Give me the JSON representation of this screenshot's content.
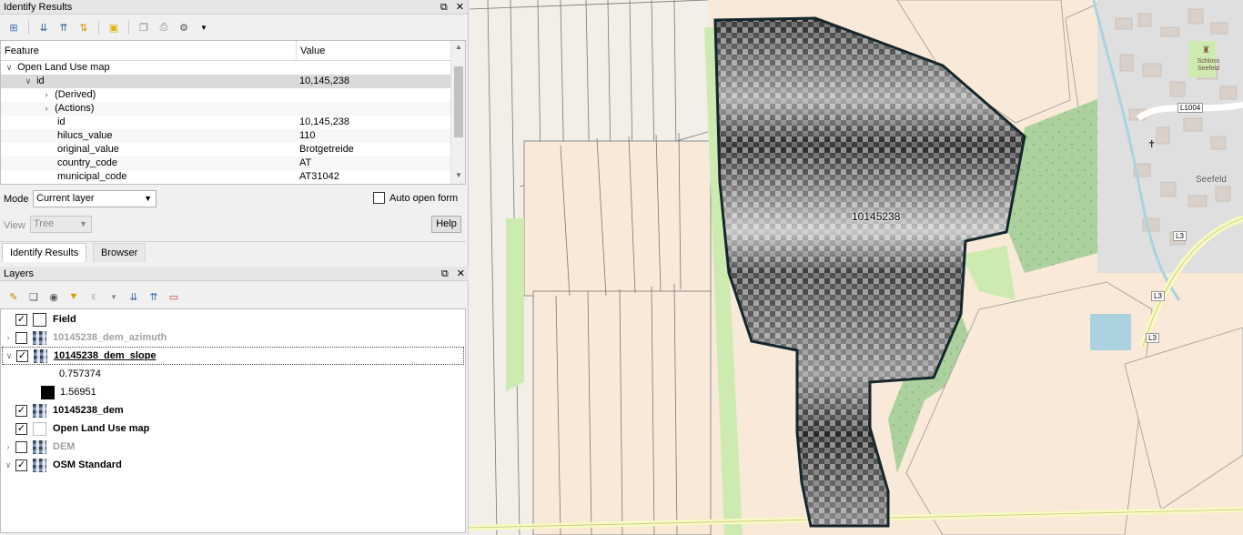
{
  "identify": {
    "title": "Identify Results",
    "columns": [
      "Feature",
      "Value"
    ],
    "rows": [
      {
        "feature": "Open Land Use map",
        "value": ""
      },
      {
        "feature": "id",
        "value": "10,145,238"
      },
      {
        "feature": "(Derived)",
        "value": ""
      },
      {
        "feature": "(Actions)",
        "value": ""
      },
      {
        "feature": "id",
        "value": "10,145,238"
      },
      {
        "feature": "hilucs_value",
        "value": "110"
      },
      {
        "feature": "original_value",
        "value": "Brotgetreide"
      },
      {
        "feature": "country_code",
        "value": "AT"
      },
      {
        "feature": "municipal_code",
        "value": "AT31042"
      }
    ],
    "mode_label": "Mode",
    "mode_value": "Current layer",
    "auto_open_label": "Auto open form",
    "view_label": "View",
    "view_value": "Tree",
    "help_label": "Help",
    "tabs": [
      "Identify Results",
      "Browser"
    ]
  },
  "layers": {
    "title": "Layers",
    "items": [
      {
        "name": "Field",
        "checked": true
      },
      {
        "name": "10145238_dem_azimuth",
        "checked": false
      },
      {
        "name": "10145238_dem_slope",
        "checked": true
      },
      {
        "name": "0.757374"
      },
      {
        "name": "1.56951"
      },
      {
        "name": "10145238_dem",
        "checked": true
      },
      {
        "name": "Open Land Use map",
        "checked": true
      },
      {
        "name": "DEM",
        "checked": false
      },
      {
        "name": "OSM Standard",
        "checked": true
      }
    ]
  },
  "map": {
    "feature_label": "10145238",
    "place_labels": [
      "Schloss Seefeld",
      "L1004",
      "Seefeld",
      "L3",
      "L3",
      "L3"
    ],
    "colors": {
      "farmland": "#f8e9d8",
      "forest": "#add19e",
      "grass": "#cdebb0",
      "road": "#ffffff",
      "major_road": "#f7fabf",
      "water": "#aad3df",
      "built": "#dddddd",
      "outline": "#15272d"
    }
  }
}
